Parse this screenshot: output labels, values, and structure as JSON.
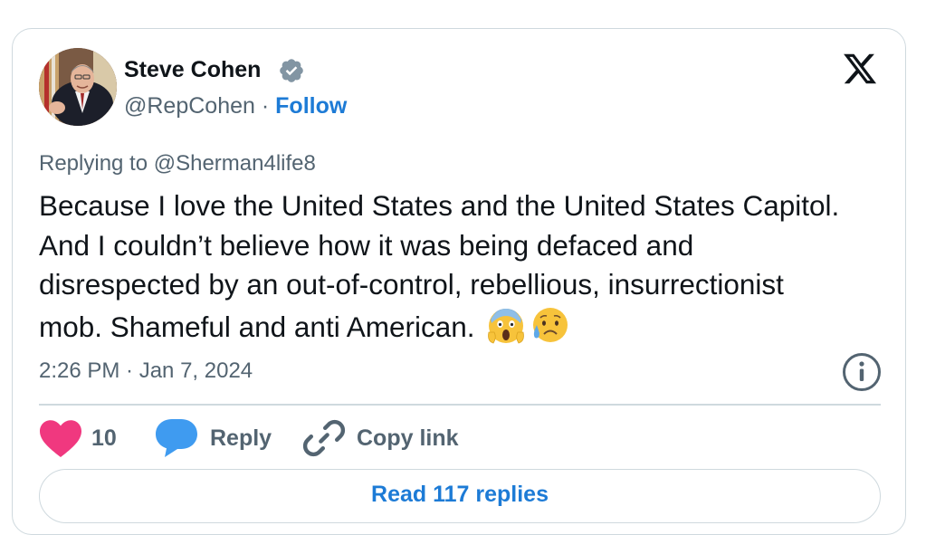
{
  "tweet": {
    "author_name": "Steve Cohen",
    "handle": "@RepCohen",
    "separator": "·",
    "follow_label": "Follow",
    "replying_to": "Replying to @Sherman4life8",
    "text": "Because I love the United States and the United States Capitol. And I couldn’t believe how it was being defaced and disrespected by an out-of-control, rebellious, insurrectionist mob. Shameful and anti American.",
    "emojis": [
      "face-screaming-in-fear-icon",
      "sad-but-relieved-face-icon"
    ],
    "timestamp": "2:26 PM · Jan 7, 2024"
  },
  "actions": {
    "like_count": "10",
    "reply_label": "Reply",
    "copy_link_label": "Copy link"
  },
  "read_replies_label": "Read 117 replies",
  "colors": {
    "accent": "#1d7bd6",
    "like": "#f0387f",
    "reply_bubble": "#3f9bf0",
    "muted": "#536471",
    "border": "#cfd9de"
  }
}
